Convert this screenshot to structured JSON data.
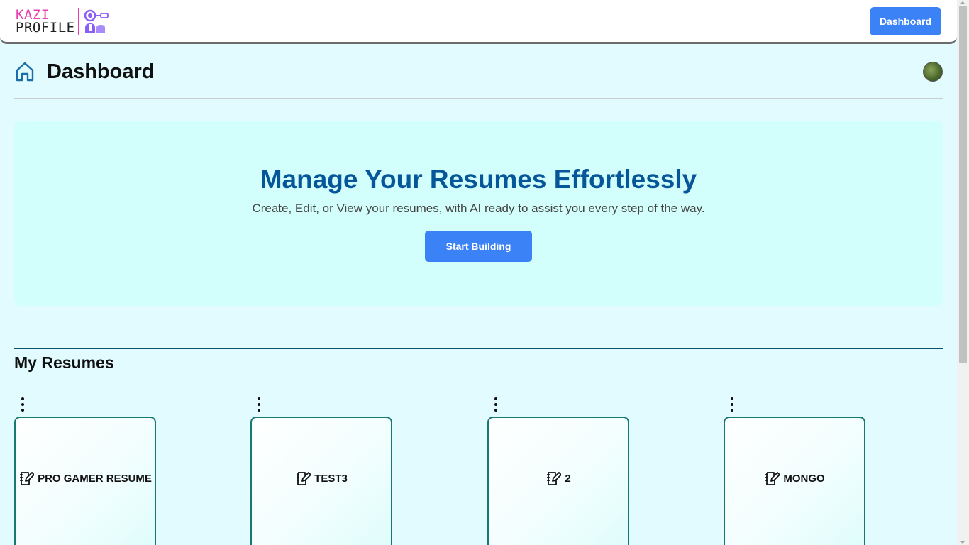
{
  "navbar": {
    "logo_top": "KAZI",
    "logo_bottom": "PROFILE",
    "dashboard_button": "Dashboard"
  },
  "header": {
    "title": "Dashboard",
    "icon": "home-icon"
  },
  "hero": {
    "title": "Manage Your Resumes Effortlessly",
    "subtitle": "Create, Edit, or View your resumes, with AI ready to assist you every step of the way.",
    "button": "Start Building"
  },
  "resumes": {
    "section_title": "My Resumes",
    "items": [
      {
        "name": "PRO GAMER RESUME"
      },
      {
        "name": "TEST3"
      },
      {
        "name": "2"
      },
      {
        "name": "MONGO"
      }
    ]
  },
  "colors": {
    "accent": "#3b82f6",
    "hero_title": "#06579a",
    "card_border": "#167a73",
    "background": "#e1fbfe",
    "logo_pink": "#e83fb0"
  }
}
